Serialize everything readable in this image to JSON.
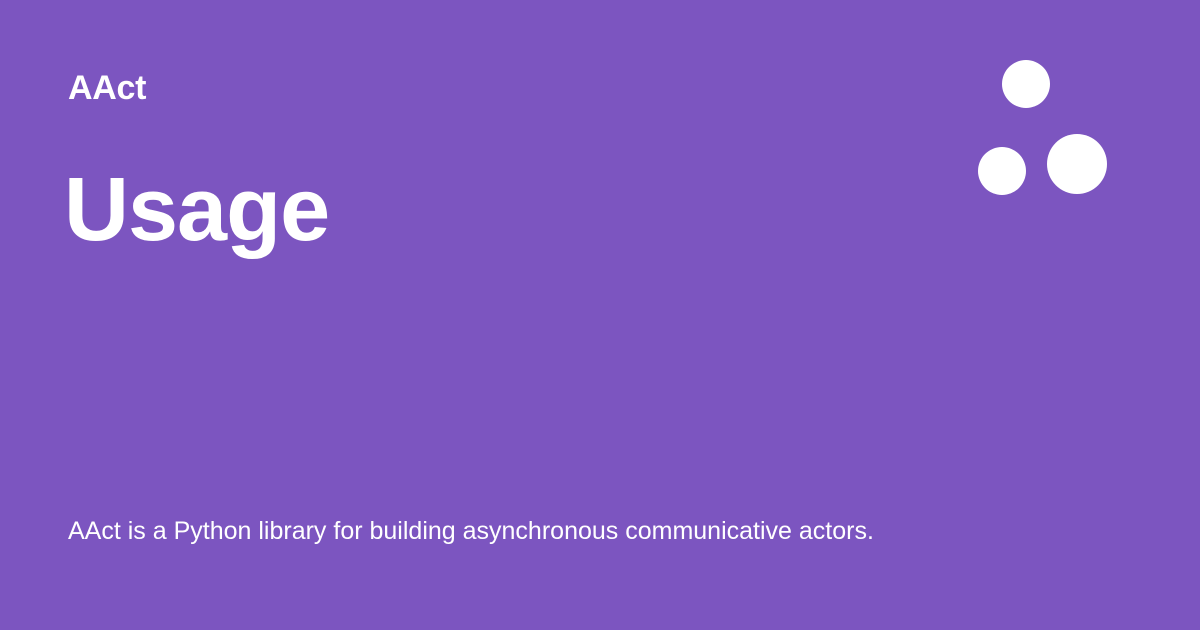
{
  "site": {
    "name": "AAct",
    "logo_icon": "three-dots-logo-icon"
  },
  "page": {
    "title": "Usage",
    "description": "AAct is a Python library for building asynchronous communicative actors."
  },
  "colors": {
    "background": "#7c55c0",
    "text": "#ffffff"
  }
}
